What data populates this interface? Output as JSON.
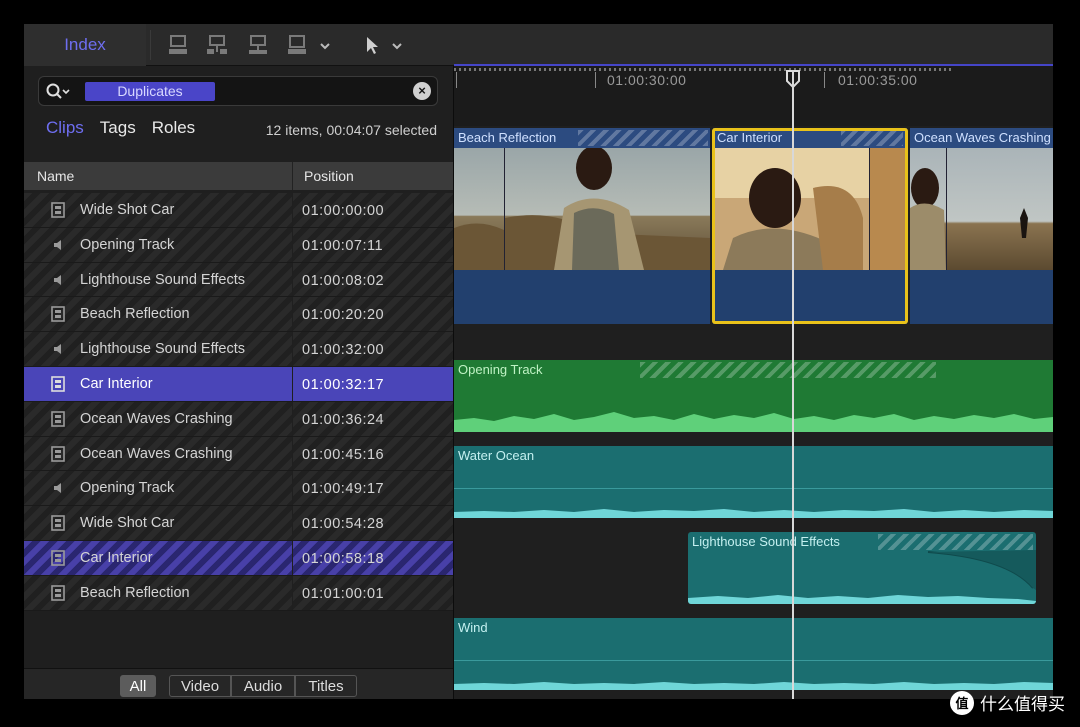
{
  "toolbar": {
    "index_label": "Index",
    "icons": [
      "append-clip-icon",
      "insert-clip-icon",
      "connect-clip-icon",
      "overwrite-clip-icon",
      "select-tool-icon"
    ]
  },
  "search": {
    "token": "Duplicates",
    "clear_icon": "×"
  },
  "filters": {
    "clips": "Clips",
    "tags": "Tags",
    "roles": "Roles",
    "summary": "12 items, 00:04:07 selected"
  },
  "columns": {
    "name": "Name",
    "position": "Position"
  },
  "rows": [
    {
      "name": "Wide Shot Car",
      "position": "01:00:00:00",
      "type": "video"
    },
    {
      "name": "Opening Track",
      "position": "01:00:07:11",
      "type": "audio"
    },
    {
      "name": "Lighthouse Sound Effects",
      "position": "01:00:08:02",
      "type": "audio"
    },
    {
      "name": "Beach Reflection",
      "position": "01:00:20:20",
      "type": "video"
    },
    {
      "name": "Lighthouse Sound Effects",
      "position": "01:00:32:00",
      "type": "audio"
    },
    {
      "name": "Car Interior",
      "position": "01:00:32:17",
      "type": "video"
    },
    {
      "name": "Ocean Waves Crashing",
      "position": "01:00:36:24",
      "type": "video"
    },
    {
      "name": "Ocean Waves Crashing",
      "position": "01:00:45:16",
      "type": "video"
    },
    {
      "name": "Opening Track",
      "position": "01:00:49:17",
      "type": "audio"
    },
    {
      "name": "Wide Shot Car",
      "position": "01:00:54:28",
      "type": "video"
    },
    {
      "name": "Car Interior",
      "position": "01:00:58:18",
      "type": "video"
    },
    {
      "name": "Beach Reflection",
      "position": "01:01:00:01",
      "type": "video"
    }
  ],
  "bottom_filters": {
    "all": "All",
    "video": "Video",
    "audio": "Audio",
    "titles": "Titles"
  },
  "timeline": {
    "ruler_labels": [
      "01:00:30:00",
      "01:00:35:00"
    ],
    "video_clips": [
      "Beach Reflection",
      "Car Interior",
      "Ocean Waves Crashing"
    ],
    "audio_clips": [
      "Opening Track",
      "Water Ocean",
      "Lighthouse Sound Effects",
      "Wind"
    ]
  },
  "watermark": {
    "logo": "值",
    "text": "什么值得买"
  },
  "colors": {
    "accent": "#4a45c8",
    "selection": "#e9c21a",
    "music_green": "#1f7a34",
    "effects_teal": "#1b6e70"
  }
}
